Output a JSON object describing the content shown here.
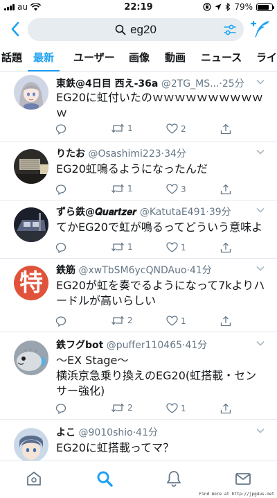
{
  "status_bar": {
    "carrier": "au",
    "time": "22:19",
    "battery": "79%",
    "battery_level": 0.79
  },
  "search": {
    "query": "eg20",
    "icons": [
      "back-arrow-icon",
      "search-icon",
      "filter-icon",
      "compose-tweet-icon"
    ]
  },
  "tabs": [
    {
      "label": "話題",
      "active": false
    },
    {
      "label": "最新",
      "active": true
    },
    {
      "label": "ユーザー",
      "active": false
    },
    {
      "label": "画像",
      "active": false
    },
    {
      "label": "動画",
      "active": false
    },
    {
      "label": "ニュース",
      "active": false
    },
    {
      "label": "ライ",
      "active": false
    }
  ],
  "tweets": [
    {
      "name": "東鉄@4日目 西え-36a",
      "handle": "@2TG_MS...",
      "time": "25分",
      "text": "EG20に虹付いたのｗｗｗｗｗｗｗｗｗｗｗ",
      "retweets": "1",
      "likes": "2",
      "avatar": "anime-girl-avatar"
    },
    {
      "name": "りたお",
      "handle": "@Osashimi223",
      "time": "34分",
      "text": "EG20虹鳴るようになったんだ",
      "retweets": "1",
      "likes": "3",
      "avatar": "train-interior-avatar"
    },
    {
      "name": "ずら鉄@𝑸𝒖𝒂𝒓𝒕𝒛𝒆𝒓",
      "handle": "@KatutaE491",
      "time": "39分",
      "text": "てかEG20で虹が鳴るってどういう意味よ",
      "retweets": "1",
      "likes": "1",
      "avatar": "train-photo-avatar"
    },
    {
      "name": "鉄筋",
      "handle": "@xwTbSM6ycQNDAuo",
      "time": "41分",
      "text": "EG20が虹を奏でるようになって7kよりハードルが高いらしい",
      "retweets": "2",
      "likes": "1",
      "avatar": "toku-kanji-avatar",
      "avatar_text": "特"
    },
    {
      "name": "鉄フグbot",
      "handle": "@puffer110465",
      "time": "41分",
      "text": "〜EX Stage〜\n横浜京急乗り換えのEG20(虹搭載・センサー強化)",
      "retweets": "2",
      "likes": "1",
      "avatar": "pufferfish-avatar"
    },
    {
      "name": "よこ",
      "handle": "@9010shio",
      "time": "41分",
      "text": "EG20に虹搭載ってマ？",
      "retweets": "",
      "likes": "",
      "avatar": "anime-boy-avatar"
    }
  ],
  "bottom_nav": [
    {
      "name": "home-icon",
      "active": false
    },
    {
      "name": "search-icon",
      "active": true
    },
    {
      "name": "notifications-icon",
      "active": false
    },
    {
      "name": "messages-icon",
      "active": false
    }
  ],
  "watermark": "Find more at http://jpg4us.net",
  "colors": {
    "accent": "#1da1f2",
    "text": "#14171a",
    "secondary": "#657786",
    "divider": "#e1e8ed",
    "search_bg": "#e6ecf0",
    "toku_avatar": "#e0533a"
  }
}
